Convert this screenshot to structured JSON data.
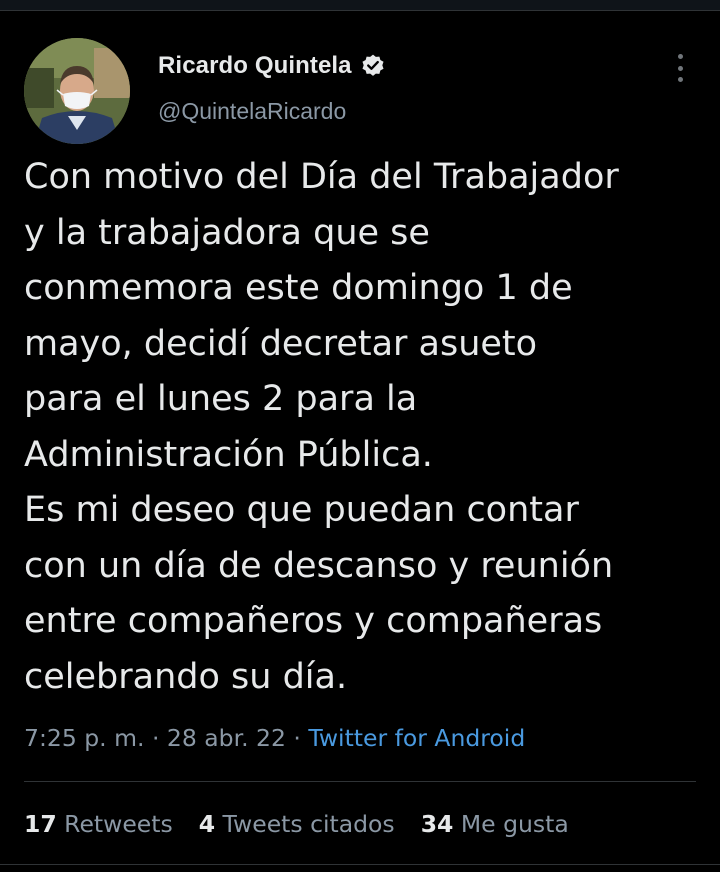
{
  "author": {
    "name": "Ricardo Quintela",
    "handle": "@QuintelaRicardo",
    "verified_icon": "verified-badge-icon"
  },
  "tweet": {
    "text": "Con motivo del Día del Trabajador\ny la trabajadora que se\nconmemora este domingo 1 de\nmayo, decidí decretar asueto\npara el lunes 2 para la\nAdministración Pública.\nEs mi deseo que puedan contar\ncon un día de descanso y reunión\nentre compañeros y compañeras\ncelebrando su día."
  },
  "meta": {
    "time": "7:25 p. m.",
    "separator": " · ",
    "date": "28 abr. 22",
    "source": "Twitter for Android"
  },
  "stats": {
    "retweets_count": "17",
    "retweets_label": " Retweets",
    "quotes_count": "4",
    "quotes_label": " Tweets citados",
    "likes_count": "34",
    "likes_label": " Me gusta"
  },
  "colors": {
    "background": "#000000",
    "text": "#e7e9ea",
    "secondary": "#8b98a5",
    "link": "#4a9ae0"
  }
}
